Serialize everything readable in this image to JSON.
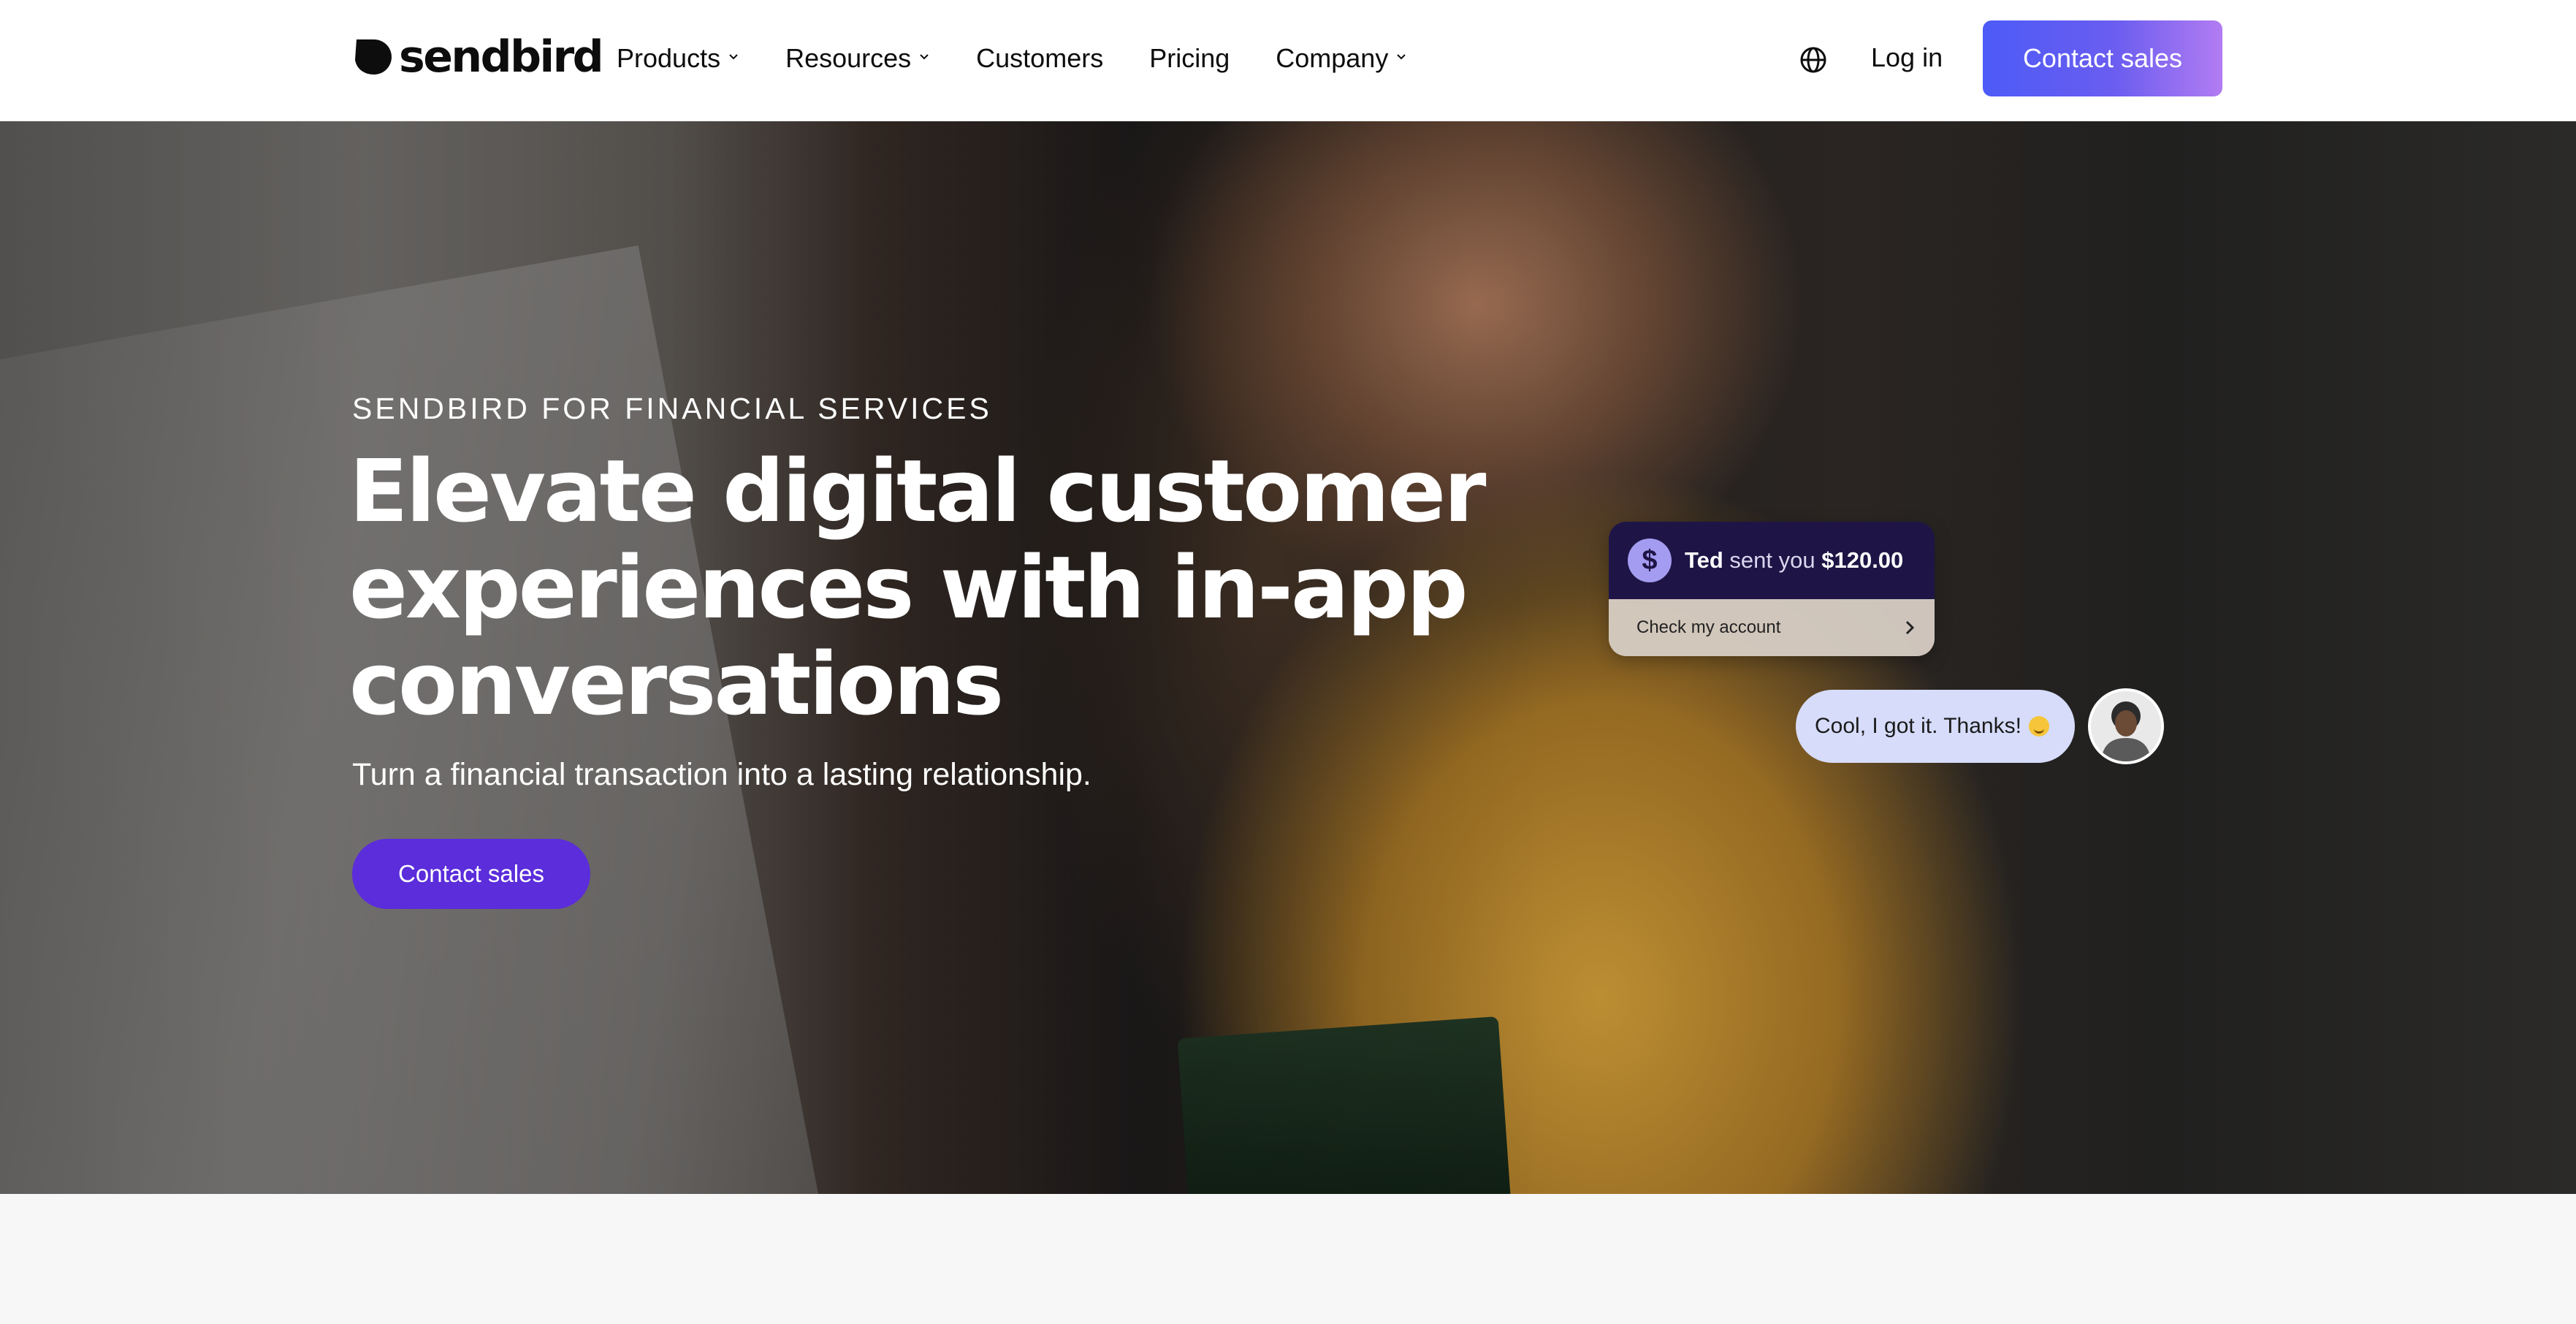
{
  "brand": {
    "name": "sendbird"
  },
  "nav": {
    "items": [
      {
        "label": "Products",
        "has_menu": true
      },
      {
        "label": "Resources",
        "has_menu": true
      },
      {
        "label": "Customers",
        "has_menu": false
      },
      {
        "label": "Pricing",
        "has_menu": false
      },
      {
        "label": "Company",
        "has_menu": true
      }
    ],
    "language_icon": "globe-icon",
    "login_label": "Log in",
    "cta_label": "Contact sales"
  },
  "hero": {
    "eyebrow": "SENDBIRD FOR FINANCIAL SERVICES",
    "headline_lines": [
      "Elevate digital customer",
      "experiences with in-app",
      "conversations"
    ],
    "subhead": "Turn a financial transaction into a lasting relationship.",
    "cta_label": "Contact sales",
    "payment_card": {
      "icon": "dollar-icon",
      "sender": "Ted",
      "middle": " sent you ",
      "amount": "$120.00",
      "link_label": "Check my account"
    },
    "reply_bubble": {
      "text": "Cool, I got it. Thanks!",
      "emoji": "smiling-face-emoji"
    }
  },
  "colors": {
    "nav_cta_gradient_start": "#4d5bf7",
    "nav_cta_gradient_end": "#b27cf2",
    "hero_cta": "#5b2ddb",
    "payment_card_header": "#1e1546",
    "reply_bubble": "#d6dcfa"
  }
}
